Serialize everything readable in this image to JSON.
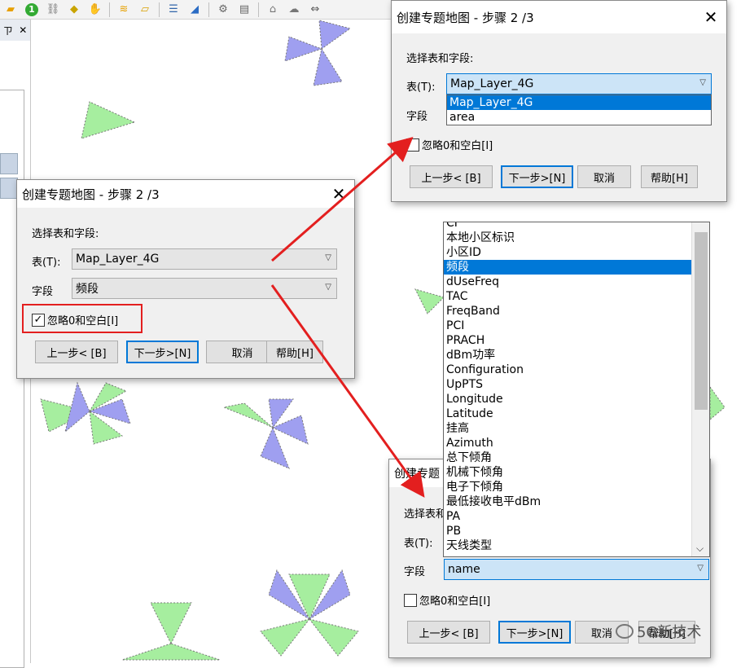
{
  "toolbar": {
    "icons": [
      "folder-icon",
      "info-icon",
      "layer-tool-icon",
      "tag-icon",
      "hand-icon",
      "layers-icon",
      "ruler-icon",
      "table-icon",
      "chart-icon",
      "settings-icon",
      "print-icon",
      "house-icon",
      "cloud-icon",
      "scale-icon"
    ]
  },
  "left_panel": {
    "pin": "ㄗ",
    "close": "✕"
  },
  "dialog_main": {
    "title": "创建专题地图 - 步骤 2 /3",
    "section_label": "选择表和字段:",
    "table_label": "表(T):",
    "table_value": "Map_Layer_4G",
    "field_label": "字段",
    "field_value": "频段",
    "ignore_label": "忽略0和空白[I]",
    "ignore_checked": "✓",
    "buttons": {
      "prev": "上一步< [B]",
      "next": "下一步>[N]",
      "cancel": "取消",
      "help": "帮助[H]"
    }
  },
  "dialog_top": {
    "title": "创建专题地图 - 步骤 2 /3",
    "section_label": "选择表和字段:",
    "table_label": "表(T):",
    "table_value": "Map_Layer_4G",
    "field_label": "字段",
    "dropdown_items": [
      "Map_Layer_4G",
      "area"
    ],
    "ignore_label": "忽略0和空白[I]",
    "buttons": {
      "prev": "上一步< [B]",
      "next": "下一步>[N]",
      "cancel": "取消",
      "help": "帮助[H]"
    }
  },
  "dialog_bottom": {
    "title": "创建专题",
    "section_label": "选择表和",
    "table_label": "表(T):",
    "field_label": "字段",
    "field_value": "name",
    "ignore_label": "忽略0和空白[I]",
    "buttons": {
      "prev": "上一步< [B]",
      "next": "下一步>[N]",
      "cancel": "取消",
      "help": "帮助[H]"
    },
    "field_list": [
      "CI",
      "本地小区标识",
      "小区ID",
      "频段",
      "dUseFreq",
      "TAC",
      "FreqBand",
      "PCI",
      "PRACH",
      "dBm功率",
      "Configuration",
      "UpPTS",
      "Longitude",
      "Latitude",
      "挂高",
      "Azimuth",
      "总下倾角",
      "机械下倾角",
      "电子下倾角",
      "最低接收电平dBm",
      "PA",
      "PB",
      "天线类型"
    ],
    "field_list_selected": "频段"
  },
  "watermark": "5G新技术",
  "colors": {
    "sector_green": "#a6ee9f",
    "sector_purple": "#9f9ff0",
    "highlight_red": "#e31f1f",
    "accent_blue": "#0078d7"
  }
}
